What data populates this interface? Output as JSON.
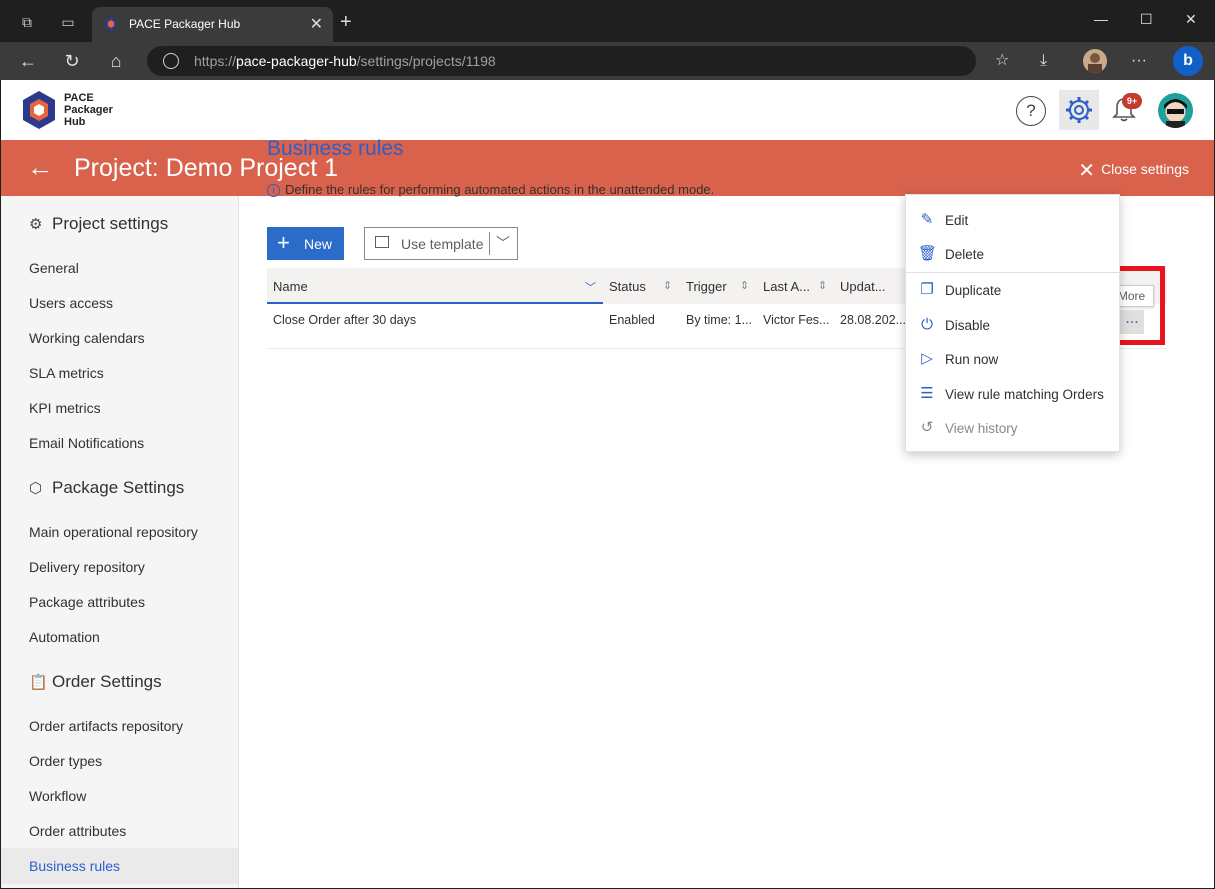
{
  "browser": {
    "tab_title": "PACE Packager Hub",
    "url_prefix": "https://",
    "url_host": "pace-packager-hub",
    "url_path": "/settings/projects/1198"
  },
  "app": {
    "logo_text_1": "PACE",
    "logo_text_2": "Packager",
    "logo_text_3": "Hub",
    "help_label": "?",
    "notifications_badge": "9+"
  },
  "banner": {
    "back_icon": "←",
    "title": "Project: Demo Project 1",
    "close_label": "Close settings"
  },
  "sidebar": {
    "sections": [
      {
        "title": "Project settings",
        "items": [
          "General",
          "Users access",
          "Working calendars",
          "SLA metrics",
          "KPI metrics",
          "Email Notifications"
        ]
      },
      {
        "title": "Package Settings",
        "items": [
          "Main operational repository",
          "Delivery repository",
          "Package attributes",
          "Automation"
        ]
      },
      {
        "title": "Order Settings",
        "items": [
          "Order artifacts repository",
          "Order types",
          "Workflow",
          "Order attributes",
          "Business rules"
        ]
      }
    ],
    "active_item": "Business rules"
  },
  "main": {
    "title": "Business rules",
    "info": "Define the rules for performing automated actions in the unattended mode.",
    "new_button": "New",
    "template_button": "Use template",
    "columns": [
      "Name",
      "Status",
      "Trigger",
      "Last A...",
      "Updat..."
    ],
    "rows": [
      {
        "name": "Close Order after 30 days",
        "status": "Enabled",
        "trigger": "By time: 1...",
        "last": "Victor Fes...",
        "updated": "28.08.202..."
      }
    ],
    "more_tooltip": "More",
    "more_glyph": "..."
  },
  "context_menu": {
    "items": [
      {
        "label": "Edit",
        "icon": "edit-icon",
        "glyph": "✎",
        "enabled": true
      },
      {
        "label": "Delete",
        "icon": "delete-icon",
        "glyph": "🗑",
        "enabled": true
      },
      {
        "label": "Duplicate",
        "icon": "duplicate-icon",
        "glyph": "❐",
        "enabled": true
      },
      {
        "label": "Disable",
        "icon": "power-icon",
        "glyph": "⏻",
        "enabled": true
      },
      {
        "label": "Run now",
        "icon": "play-icon",
        "glyph": "▷",
        "enabled": true
      },
      {
        "label": "View rule matching Orders",
        "icon": "list-icon",
        "glyph": "☰",
        "enabled": true
      },
      {
        "label": "View history",
        "icon": "history-icon",
        "glyph": "↺",
        "enabled": false
      }
    ]
  },
  "colors": {
    "banner": "#d9624c",
    "accent": "#2b5fc9",
    "highlight": "#e8141e"
  }
}
